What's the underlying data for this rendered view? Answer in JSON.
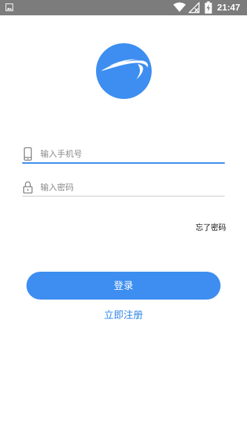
{
  "status_bar": {
    "time": "21:47",
    "background_color": "#7c7c7c",
    "icons": [
      "image-icon",
      "wifi-icon",
      "signal-off-icon",
      "battery-charging-icon"
    ]
  },
  "logo": {
    "icon": "app-logo-swoosh",
    "color": "#3d8ef0"
  },
  "form": {
    "phone_placeholder": "输入手机号",
    "phone_value": "",
    "phone_icon": "phone-icon",
    "password_placeholder": "输入密码",
    "password_value": "",
    "password_icon": "lock-icon",
    "forgot_label": "忘了密码",
    "login_label": "登录",
    "register_label": "立即注册"
  },
  "colors": {
    "accent": "#3d8ef0",
    "link": "#2f85e8",
    "underline_inactive": "#c8c8c8"
  }
}
